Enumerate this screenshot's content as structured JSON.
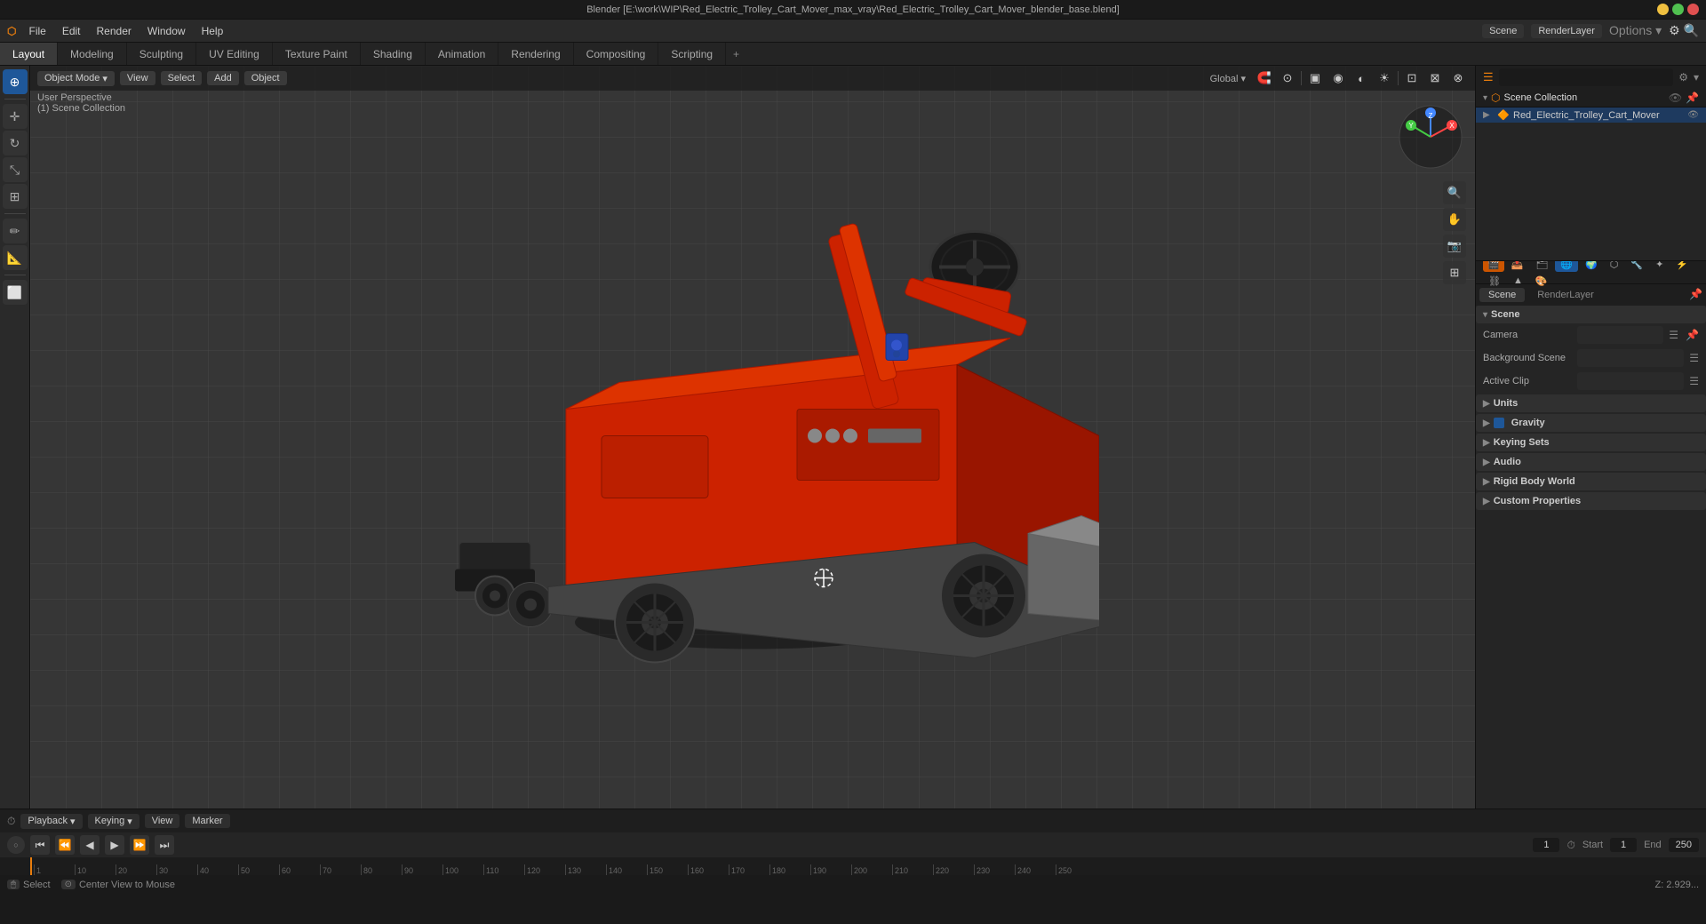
{
  "window": {
    "title": "Blender [E:\\work\\WIP\\Red_Electric_Trolley_Cart_Mover_max_vray\\Red_Electric_Trolley_Cart_Mover_blender_base.blend]"
  },
  "menu": {
    "items": [
      "Blender",
      "File",
      "Edit",
      "Render",
      "Window",
      "Help"
    ]
  },
  "workspace_tabs": {
    "tabs": [
      "Layout",
      "Modeling",
      "Sculpting",
      "UV Editing",
      "Texture Paint",
      "Shading",
      "Animation",
      "Rendering",
      "Compositing",
      "Scripting"
    ],
    "active": "Layout",
    "add_label": "+"
  },
  "viewport": {
    "mode_label": "Object Mode",
    "view_label": "View",
    "select_label": "Select",
    "add_label": "Add",
    "object_label": "Object",
    "viewport_shading": "Solid",
    "perspective": "User Perspective",
    "collection": "(1) Scene Collection",
    "global_label": "Global"
  },
  "outliner": {
    "title": "Scene Collection",
    "search_placeholder": "",
    "items": [
      {
        "label": "Red_Electric_Trolley_Cart_Mover",
        "icon": "📦",
        "level": 1,
        "expanded": false
      }
    ]
  },
  "properties": {
    "scene_label": "Scene",
    "renderlayer_label": "RenderLayer",
    "sections": {
      "scene": {
        "label": "Scene",
        "camera_label": "Camera",
        "bg_scene_label": "Background Scene",
        "active_clip_label": "Active Clip"
      },
      "units": {
        "label": "Units"
      },
      "gravity": {
        "label": "Gravity",
        "checked": true
      },
      "keying_sets": {
        "label": "Keying Sets"
      },
      "audio": {
        "label": "Audio"
      },
      "rigid_body_world": {
        "label": "Rigid Body World"
      },
      "custom_properties": {
        "label": "Custom Properties"
      }
    }
  },
  "timeline": {
    "playback_label": "Playback",
    "keying_label": "Keying",
    "view_label": "View",
    "marker_label": "Marker",
    "start_label": "Start",
    "end_label": "End",
    "start_value": "1",
    "end_value": "250",
    "current_frame": "1",
    "ruler_marks": [
      "1",
      "10",
      "20",
      "30",
      "40",
      "50",
      "60",
      "70",
      "80",
      "90",
      "100",
      "110",
      "120",
      "130",
      "140",
      "150",
      "160",
      "170",
      "180",
      "190",
      "200",
      "210",
      "220",
      "230",
      "240",
      "250"
    ]
  },
  "status_bar": {
    "select_label": "Select",
    "center_view_label": "Center View to Mouse",
    "coords": "Z: 2.929..."
  },
  "icons": {
    "cursor": "⊕",
    "move": "✛",
    "rotate": "↻",
    "scale": "⤡",
    "transform": "⊞",
    "annotate": "✏",
    "measure": "📏",
    "add_cube": "⬜",
    "search": "🔍",
    "zoom_in": "🔍",
    "hand": "✋",
    "camera": "📷",
    "display": "🖥",
    "chevron_down": "▾",
    "chevron_right": "▶",
    "triangle_right": "▶"
  }
}
